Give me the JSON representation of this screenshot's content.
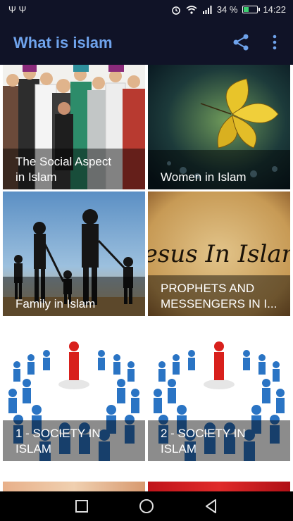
{
  "status": {
    "battery": "34 %",
    "time": "14:22",
    "usb": "Ψ Ψ"
  },
  "app": {
    "title": "What is islam"
  },
  "tiles": [
    {
      "label": "The Social Aspect\nin Islam"
    },
    {
      "label": "Women in Islam"
    },
    {
      "label": "Family in Islam"
    },
    {
      "label": "PROPHETS AND\nMESSENGERS IN I..."
    },
    {
      "label": "1 - SOCIETY IN\nISLAM"
    },
    {
      "label": "2 - SOCIETY IN\nISLAM"
    }
  ],
  "art": {
    "jesus_text": "Jesus In Islam"
  },
  "colors": {
    "accent": "#6fa3ec",
    "appbar": "#101327"
  },
  "icons": [
    "share-icon",
    "more-vert-icon",
    "square-icon",
    "circle-icon",
    "back-triangle-icon",
    "wifi-icon",
    "alarm-icon",
    "battery-icon"
  ]
}
